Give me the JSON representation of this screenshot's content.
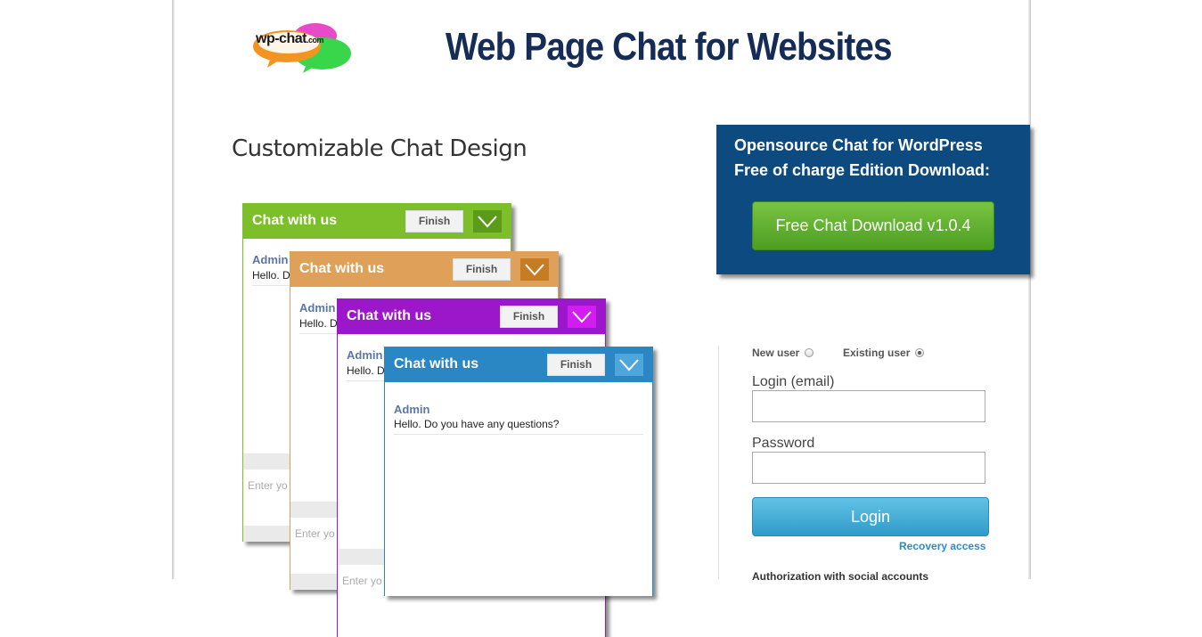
{
  "header": {
    "logo_text": "wp-chat",
    "logo_suffix": ".com",
    "title": "Web Page Chat for Websites"
  },
  "section_heading": "Customizable Chat Design",
  "download": {
    "line1": "Opensource Chat for WordPress",
    "line2": "Free of charge Edition Download:",
    "button_label": "Free Chat Download v1.0.4"
  },
  "chat_windows": [
    {
      "title": "Chat with us",
      "finish": "Finish",
      "author": "Admin",
      "message": "Hello. D",
      "input_placeholder": "Enter yo",
      "color": "#7dbf2a",
      "toggle_color": "#5c9a1a"
    },
    {
      "title": "Chat with us",
      "finish": "Finish",
      "author": "Admin",
      "message": "Hello. D",
      "input_placeholder": "Enter yo",
      "color": "#dfa05a",
      "toggle_color": "#c57c23"
    },
    {
      "title": "Chat with us",
      "finish": "Finish",
      "author": "Admin",
      "message": "Hello. D",
      "input_placeholder": "Enter yo",
      "color": "#9b17c9",
      "toggle_color": "#d21cf0"
    },
    {
      "title": "Chat with us",
      "finish": "Finish",
      "author": "Admin",
      "message": "Hello. Do you have any questions?",
      "input_placeholder": "",
      "color": "#2b87c4",
      "toggle_color": "#4fa6dc"
    }
  ],
  "login": {
    "new_user_label": "New user",
    "existing_user_label": "Existing user",
    "selected_mode": "existing",
    "email_label": "Login (email)",
    "email_value": "",
    "password_label": "Password",
    "password_value": "",
    "login_button": "Login",
    "recovery_link": "Recovery access",
    "social_label": "Authorization with social accounts"
  }
}
